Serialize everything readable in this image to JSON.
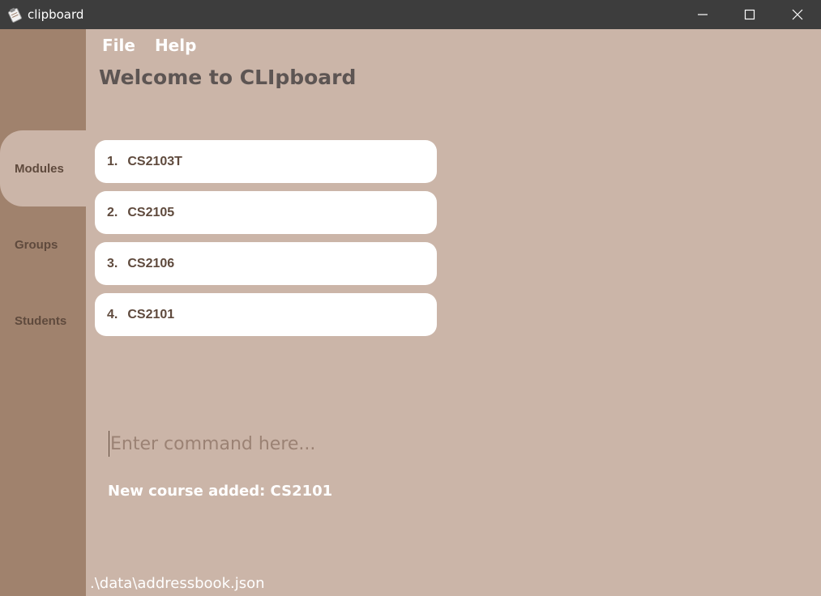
{
  "window": {
    "title": "clipboard",
    "app_icon": "clipboard-app-icon",
    "controls": [
      "minimize-icon",
      "maximize-icon",
      "close-icon"
    ]
  },
  "menu": {
    "file": "File",
    "help": "Help"
  },
  "welcome": "Welcome to CLIpboard",
  "sidebar": {
    "items": [
      {
        "label": "Modules",
        "active": true
      },
      {
        "label": "Groups",
        "active": false
      },
      {
        "label": "Students",
        "active": false
      }
    ]
  },
  "modules": [
    {
      "index": "1.",
      "code": "CS2103T"
    },
    {
      "index": "2.",
      "code": "CS2105"
    },
    {
      "index": "3.",
      "code": "CS2106"
    },
    {
      "index": "4.",
      "code": "CS2101"
    }
  ],
  "command": {
    "placeholder": "Enter command here...",
    "value": ""
  },
  "result": "New course added: CS2101",
  "status": {
    "path": ".\\data\\addressbook.json"
  },
  "colors": {
    "titlebar": "#3d3d3d",
    "sidebar": "#a0826d",
    "background": "#cbb5a8",
    "card": "#ffffff",
    "text_dark": "#5f4a3d",
    "welcome_text": "#5d5553"
  }
}
